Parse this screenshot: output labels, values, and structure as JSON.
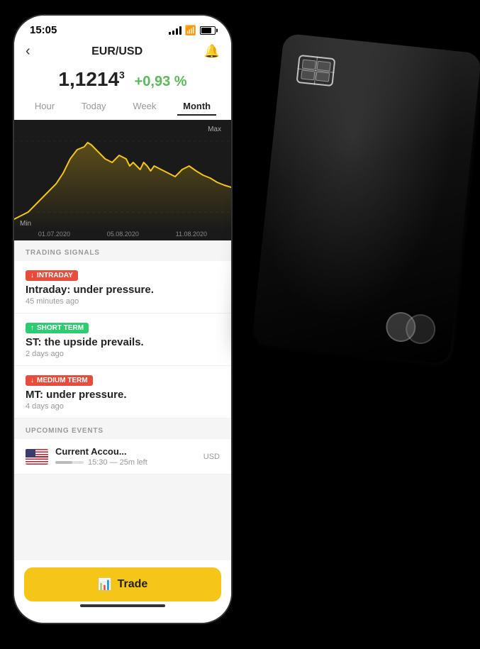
{
  "statusBar": {
    "time": "15:05"
  },
  "header": {
    "back": "‹",
    "title": "EUR/USD",
    "bell": "🔔"
  },
  "price": {
    "value": "1,1214",
    "superscript": "3",
    "change": "+0,93 %"
  },
  "tabs": [
    {
      "label": "Hour",
      "active": false
    },
    {
      "label": "Today",
      "active": false
    },
    {
      "label": "Week",
      "active": false
    },
    {
      "label": "Month",
      "active": true
    }
  ],
  "chart": {
    "maxLabel": "Max",
    "minLabel": "Min",
    "dates": [
      "01.07.2020",
      "05.08.2020",
      "11.08.2020"
    ]
  },
  "tradingSignals": {
    "sectionTitle": "TRADING SIGNALS",
    "items": [
      {
        "badge": "↓ INTRADAY",
        "badgeType": "red",
        "title": "Intraday: under pressure.",
        "time": "45 minutes ago"
      },
      {
        "badge": "↑ SHORT TERM",
        "badgeType": "green",
        "title": "ST: the upside prevails.",
        "time": "2 days ago"
      },
      {
        "badge": "↓ MEDIUM TERM",
        "badgeType": "red",
        "title": "MT: under pressure.",
        "time": "4 days ago"
      }
    ]
  },
  "upcomingEvents": {
    "sectionTitle": "UPCOMING EVENTS",
    "items": [
      {
        "currency": "USD",
        "name": "Current Accou...",
        "time": "15:30 — 25m left"
      }
    ]
  },
  "tradeButton": {
    "label": "Trade",
    "icon": "📊"
  }
}
